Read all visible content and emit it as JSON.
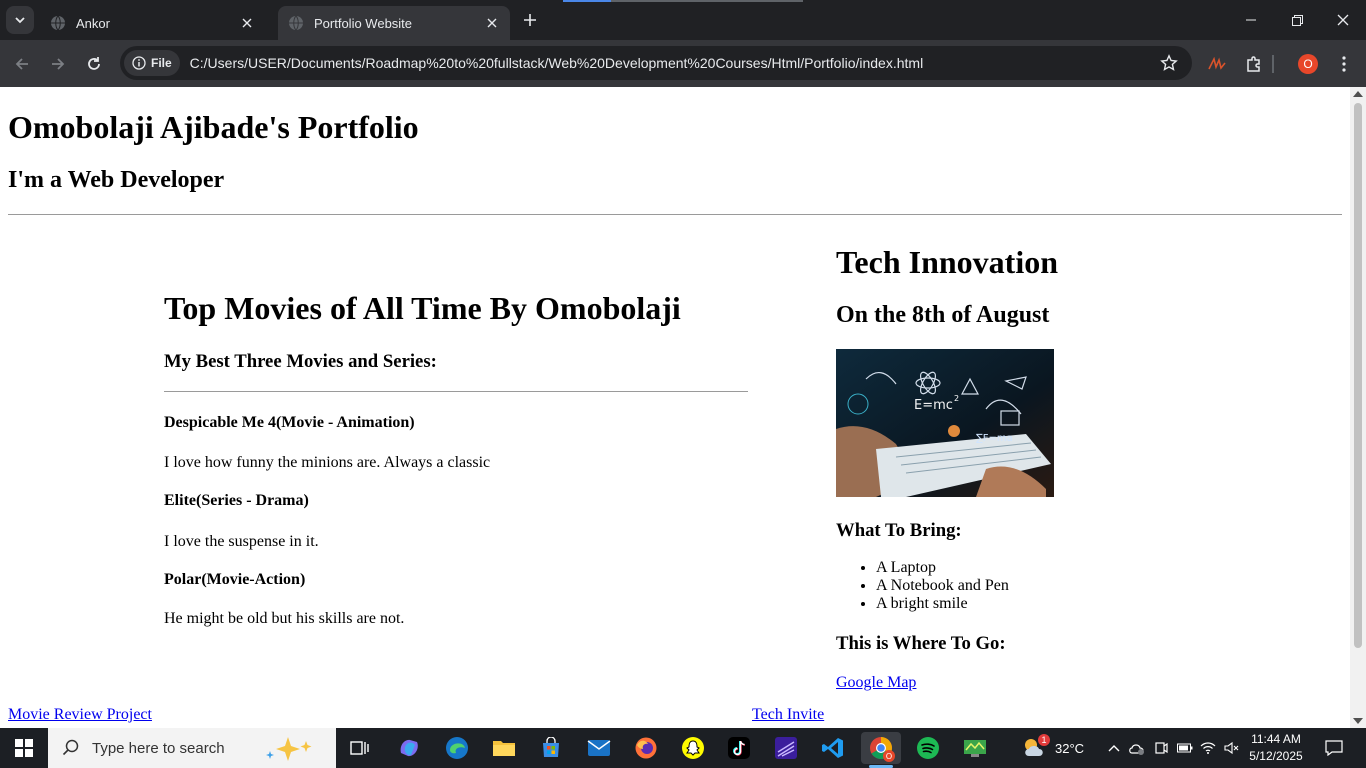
{
  "browser": {
    "tabs": [
      {
        "title": "Ankor",
        "active": false
      },
      {
        "title": "Portfolio Website",
        "active": true
      }
    ],
    "site_chip": "File",
    "url": "C:/Users/USER/Documents/Roadmap%20to%20fullstack/Web%20Development%20Courses/Html/Portfolio/index.html",
    "profile_initial": "O"
  },
  "page": {
    "title": "Omobolaji Ajibade's Portfolio",
    "subtitle": "I'm a Web Developer",
    "movies": {
      "title": "Top Movies of All Time By Omobolaji",
      "subtitle": "My Best Three Movies and Series:",
      "items": [
        {
          "name": "Despicable Me 4(Movie - Animation)",
          "desc": "I love how funny the minions are. Always a classic"
        },
        {
          "name": "Elite(Series - Drama)",
          "desc": "I love the suspense in it."
        },
        {
          "name": "Polar(Movie-Action)",
          "desc": "He might be old but his skills are not."
        }
      ]
    },
    "tech": {
      "title": "Tech Innovation",
      "date": "On the 8th of August",
      "bring_title": "What To Bring:",
      "bring_items": [
        "A Laptop",
        "A Notebook and Pen",
        "A bright smile"
      ],
      "where_title": "This is Where To Go:",
      "map_link": "Google Map"
    },
    "footer_links": {
      "movie": "Movie Review Project",
      "tech": "Tech Invite"
    }
  },
  "taskbar": {
    "search_placeholder": "Type here to search",
    "temperature": "32°C",
    "weather_badge": "1",
    "time": "11:44 AM",
    "date": "5/12/2025"
  }
}
